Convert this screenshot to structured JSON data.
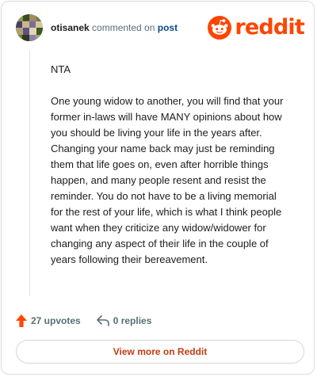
{
  "header": {
    "username": "otisanek",
    "action_text": "commented on",
    "post_link": "post",
    "logo_text": "reddit"
  },
  "comment": {
    "paragraphs": [
      "NTA",
      "One young widow to another, you will find that your former in-laws will have MANY opinions about how you should be living your life in the years after. Changing your name back may just be reminding them that life goes on, even after horrible things happen, and many people resent and resist the reminder. You do not have to be a living memorial for the rest of your life, which is what I think people want when they criticize any widow/widower for changing any aspect of their life in the couple of years following their bereavement."
    ]
  },
  "actions": {
    "upvotes_label": "27 upvotes",
    "replies_label": "0 replies"
  },
  "footer": {
    "view_more_label": "View more on Reddit"
  },
  "colors": {
    "brand": "#ff4500",
    "link": "#0a4a8a",
    "muted": "#576f76",
    "view_more": "#c23b12"
  },
  "icons": {
    "avatar": "user-avatar",
    "logo": "reddit-snoo-icon",
    "upvote": "upvote-arrow-icon",
    "reply": "reply-arrow-icon"
  }
}
